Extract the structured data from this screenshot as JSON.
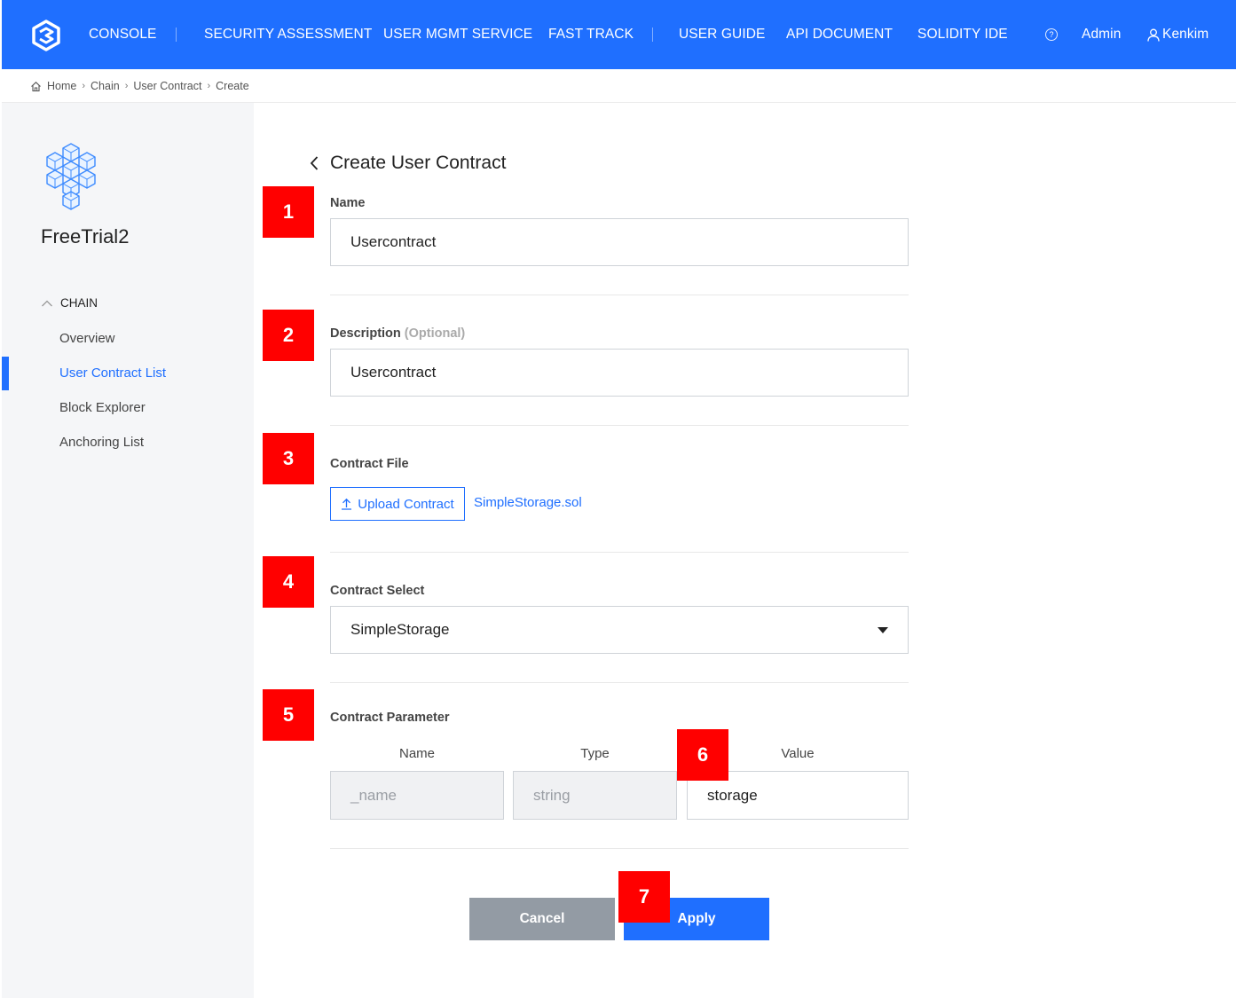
{
  "topnav": {
    "items": [
      "CONSOLE",
      "SECURITY ASSESSMENT",
      "USER MGMT SERVICE",
      "FAST TRACK",
      "USER GUIDE",
      "API DOCUMENT",
      "SOLIDITY IDE"
    ],
    "admin_label": "Admin",
    "user_label": "Kenkim",
    "help_glyph": "?"
  },
  "breadcrumb": [
    "Home",
    "Chain",
    "User Contract",
    "Create"
  ],
  "sidebar": {
    "project_name": "FreeTrial2",
    "section_label": "CHAIN",
    "items": [
      "Overview",
      "User Contract List",
      "Block Explorer",
      "Anchoring List"
    ],
    "active_item": "User Contract List"
  },
  "page": {
    "title": "Create User Contract"
  },
  "form": {
    "name_label": "Name",
    "name_value": "Usercontract",
    "description_label": "Description",
    "description_optional": "(Optional)",
    "description_value": "Usercontract",
    "contract_file_label": "Contract File",
    "upload_button_label": "Upload Contract",
    "uploaded_file_name": "SimpleStorage.sol",
    "contract_select_label": "Contract Select",
    "contract_select_value": "SimpleStorage",
    "contract_parameter_label": "Contract Parameter",
    "param_columns": [
      "Name",
      "Type",
      "Value"
    ],
    "param_rows": [
      {
        "name": "_name",
        "type": "string",
        "value": "storage"
      }
    ],
    "cancel_label": "Cancel",
    "apply_label": "Apply"
  },
  "annotations": [
    "1",
    "2",
    "3",
    "4",
    "5",
    "6",
    "7"
  ],
  "colors": {
    "primary": "#1f6fff",
    "annotation_badge": "#ff0000",
    "cancel_button": "#939ba4"
  }
}
